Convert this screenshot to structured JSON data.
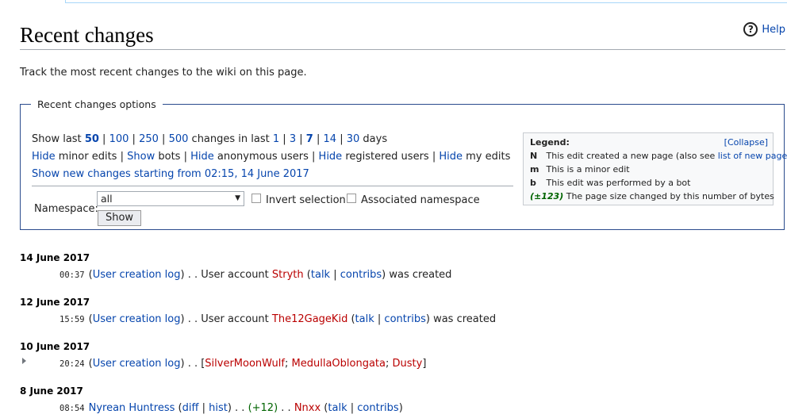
{
  "page_title": "Recent changes",
  "help_label": "Help",
  "intro": "Track the most recent changes to the wiki on this page.",
  "options": {
    "legend": "Recent changes options",
    "show_last_prefix": "Show last",
    "limits": [
      "50",
      "100",
      "250",
      "500"
    ],
    "selected_limit": "50",
    "changes_in_last": "changes in last",
    "days": [
      "1",
      "3",
      "7",
      "14",
      "30"
    ],
    "selected_days": "7",
    "days_suffix": "days",
    "toggles": [
      {
        "action": "Hide",
        "text": "minor edits"
      },
      {
        "action": "Show",
        "text": "bots"
      },
      {
        "action": "Hide",
        "text": "anonymous users"
      },
      {
        "action": "Hide",
        "text": "registered users"
      },
      {
        "action": "Hide",
        "text": "my edits"
      }
    ],
    "show_new_link": "Show new changes starting from 02:15, 14 June 2017",
    "namespace_label": "Namespace:",
    "namespace_value": "all",
    "invert_label": "Invert selection",
    "associated_label": "Associated namespace",
    "show_button": "Show"
  },
  "legend": {
    "title": "Legend:",
    "collapse": "[Collapse]",
    "rows": [
      {
        "key": "N",
        "text": "This edit created a new page (also see ",
        "link": "list of new pages",
        "after": ")"
      },
      {
        "key": "m",
        "text": "This is a minor edit"
      },
      {
        "key": "b",
        "text": "This edit was performed by a bot"
      },
      {
        "key": "(±123)",
        "text": "The page size changed by this number of bytes"
      }
    ]
  },
  "days": [
    {
      "date": "14 June 2017",
      "entry": {
        "time": "00:37",
        "log": "User creation log",
        "text_before": "User account",
        "user": "Stryth",
        "talk": "talk",
        "contribs": "contribs",
        "text_after": "was created"
      }
    },
    {
      "date": "12 June 2017",
      "entry": {
        "time": "15:59",
        "log": "User creation log",
        "text_before": "User account",
        "user": "The12GageKid",
        "talk": "talk",
        "contribs": "contribs",
        "text_after": "was created"
      }
    },
    {
      "date": "10 June 2017",
      "entry": {
        "time": "20:24",
        "log": "User creation log",
        "users": [
          "SilverMoonWulf",
          "MedullaOblongata",
          "Dusty"
        ]
      }
    },
    {
      "date": "8 June 2017",
      "entry": {
        "time": "08:54",
        "page": "Nyrean Huntress",
        "diff": "diff",
        "hist": "hist",
        "size": "(+12)",
        "user": "Nnxx",
        "talk": "talk",
        "contribs": "contribs"
      }
    }
  ],
  "colors": {
    "link": "#0645ad",
    "redlink": "#ba0000",
    "border": "#2a4b8d",
    "positive": "#006400"
  }
}
